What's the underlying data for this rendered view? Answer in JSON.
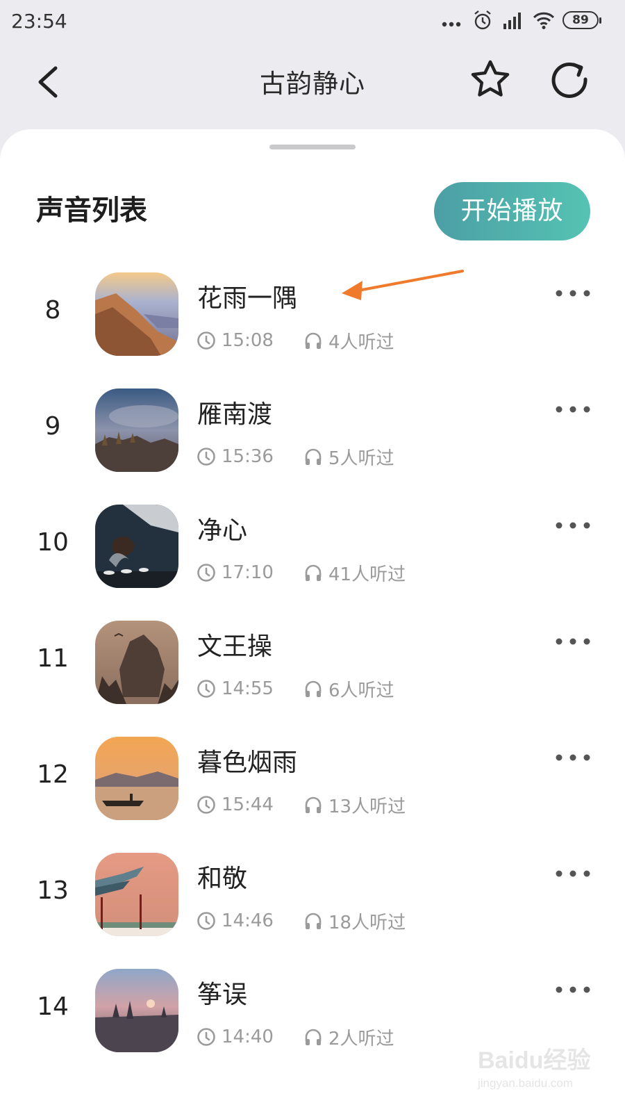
{
  "status_bar": {
    "time": "23:54",
    "battery": "89"
  },
  "header": {
    "title": "古韵静心"
  },
  "list": {
    "title": "声音列表",
    "play_button": "开始播放",
    "tracks": [
      {
        "num": "8",
        "title": "花雨一隅",
        "duration": "15:08",
        "listens": "4人听过"
      },
      {
        "num": "9",
        "title": "雁南渡",
        "duration": "15:36",
        "listens": "5人听过"
      },
      {
        "num": "10",
        "title": "净心",
        "duration": "17:10",
        "listens": "41人听过"
      },
      {
        "num": "11",
        "title": "文王操",
        "duration": "14:55",
        "listens": "6人听过"
      },
      {
        "num": "12",
        "title": "暮色烟雨",
        "duration": "15:44",
        "listens": "13人听过"
      },
      {
        "num": "13",
        "title": "和敬",
        "duration": "14:46",
        "listens": "18人听过"
      },
      {
        "num": "14",
        "title": "筝误",
        "duration": "14:40",
        "listens": "2人听过"
      }
    ]
  },
  "watermark": {
    "logo": "Baidu经验",
    "url": "jingyan.baidu.com"
  },
  "colors": {
    "accent_start": "#4c9fa5",
    "accent_end": "#55c3b3",
    "annotation_arrow": "#f07a2c",
    "underline": "#f5cf7e"
  }
}
